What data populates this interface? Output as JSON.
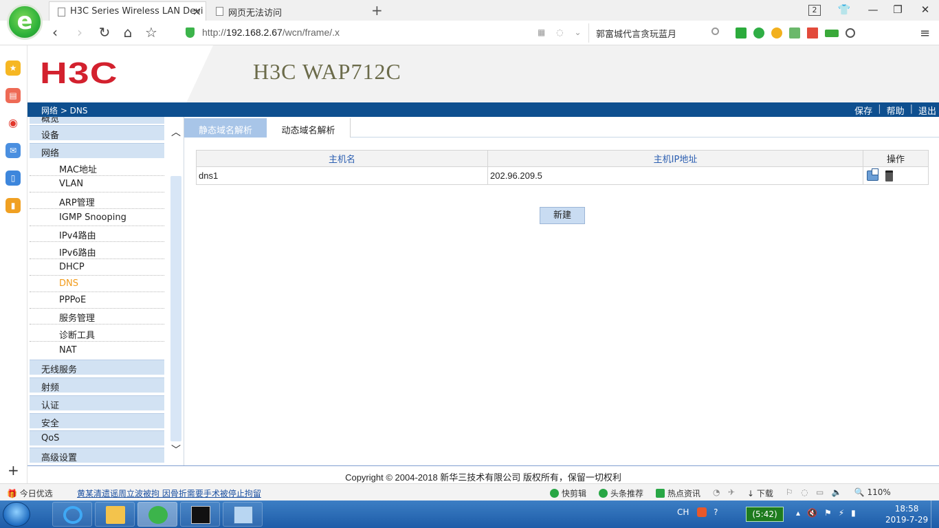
{
  "browser": {
    "tabs": [
      {
        "title": "H3C Series Wireless LAN Devi",
        "active": true
      },
      {
        "title": "网页无法访问",
        "active": false
      }
    ],
    "tab_count": "2",
    "url_prefix": "http://",
    "url_host": "192.168.2.67",
    "url_path": "/wcn/frame/.x",
    "search_text": "郭富城代言贪玩蓝月"
  },
  "header": {
    "logo": "H3C",
    "product_name": "H3C WAP712C"
  },
  "bluebar": {
    "breadcrumb": "网络 > DNS",
    "links": [
      "保存",
      "帮助",
      "退出"
    ]
  },
  "nav": {
    "top_cut": "概览",
    "device": "设备",
    "network": "网络",
    "sub_items": [
      "MAC地址",
      "VLAN",
      "ARP管理",
      "IGMP Snooping",
      "IPv4路由",
      "IPv6路由",
      "DHCP",
      "DNS",
      "PPPoE",
      "服务管理",
      "诊断工具",
      "NAT"
    ],
    "active_sub": "DNS",
    "bottom_items": [
      "无线服务",
      "射频",
      "认证",
      "安全",
      "QoS",
      "高级设置"
    ]
  },
  "content": {
    "tabs": [
      "静态域名解析",
      "动态域名解析"
    ],
    "table": {
      "headers": [
        "主机名",
        "主机IP地址",
        "操作"
      ],
      "rows": [
        {
          "hostname": "dns1",
          "ip": "202.96.209.5"
        }
      ]
    },
    "new_button": "新建"
  },
  "footer": "Copyright © 2004-2018 新华三技术有限公司 版权所有，保留一切权利",
  "statusbar": {
    "left": "今日优选",
    "news": "黄某清遗谣周立波被拘 因骨折需要手术被停止拘留",
    "right_items": [
      "快剪辑",
      "头条推荐",
      "热点资讯",
      "下载",
      "110%"
    ]
  },
  "taskbar": {
    "tray_lang": "CH",
    "battery": "(5:42)",
    "time": "18:58",
    "date": "2019-7-29"
  },
  "colors": {
    "brand_red": "#d3212e",
    "bluebar": "#0e4f8f",
    "active_nav": "#f29b1a",
    "nav_bg": "#d2e2f3"
  }
}
